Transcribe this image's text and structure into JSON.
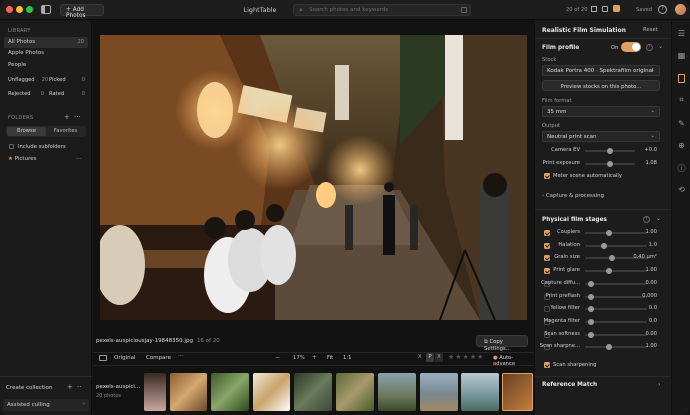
{
  "app": {
    "title": "LightTable",
    "counter": "20 of 20",
    "saved": "Saved",
    "add_photos": "Add Photos",
    "search_placeholder": "Search photos and keywords"
  },
  "library": {
    "header": "LIBRARY",
    "items": [
      {
        "label": "All Photos",
        "count": "20"
      },
      {
        "label": "Apple Photos",
        "count": ""
      },
      {
        "label": "People",
        "count": ""
      }
    ],
    "unflagged": "Unflagged",
    "unflagged_count": "20",
    "picked": "Picked",
    "picked_count": "0",
    "rejected": "Rejected",
    "rejected_count": "0",
    "rated": "Rated",
    "rated_count": "0"
  },
  "folders": {
    "header": "FOLDERS",
    "tab_browse": "Browse",
    "tab_favorites": "Favorites",
    "include_sub": "Include subfolders",
    "pictures": "Pictures"
  },
  "sidebar_bottom": {
    "create": "Create collection",
    "assisted": "Assisted culling"
  },
  "photo": {
    "filename": "pexels-auspiciousjay-19848350.jpg",
    "position": "16 of 20",
    "copy_settings": "Copy Settings..."
  },
  "toolbar": {
    "original": "Original",
    "compare": "Compare",
    "zoom": "17%",
    "fit": "Fit",
    "one_to_one": "1:1",
    "flag_p": "P",
    "flag_x": "X",
    "stars": "★★★★★",
    "auto_advance": "Auto-advance"
  },
  "filmstrip": {
    "name": "pexels-auspici...",
    "count": "20 photos"
  },
  "panel": {
    "title": "Realistic Film Simulation",
    "reset": "Reset",
    "film_profile": "Film profile",
    "on": "On",
    "stock_label": "Stock",
    "stock_value": "Kodak Portra 400 · Spektrafilm original",
    "preview_btn": "Preview stocks on this photo...",
    "format_label": "Film format",
    "format_value": "35 mm",
    "output_label": "Output",
    "output_value": "Neutral print scan",
    "camera_ev": "Camera EV",
    "camera_ev_val": "+0.0",
    "print_exposure": "Print exposure",
    "print_exposure_val": "1.08",
    "meter_scene": "Meter scene automatically",
    "capture": "Capture & processing",
    "stages": "Physical film stages",
    "stage_rows": [
      {
        "label": "Couplers",
        "val": "1.00",
        "check": true,
        "pos": 0.38
      },
      {
        "label": "Halation",
        "val": "1.0",
        "check": true,
        "pos": 0.28
      },
      {
        "label": "Grain size",
        "val": "0.40 µm²",
        "check": true,
        "pos": 0.42
      },
      {
        "label": "Print glare",
        "val": "1.00",
        "check": true,
        "pos": 0.38
      },
      {
        "label": "Capture diffu...",
        "val": "0.00",
        "check": false,
        "pos": 0.05
      },
      {
        "label": "Print preflash",
        "val": "0.000",
        "check": false,
        "pos": 0.05
      },
      {
        "label": "Yellow filter",
        "val": "0.0",
        "check": false,
        "pos": 0.05
      },
      {
        "label": "Magenta filter",
        "val": "0.0",
        "check": false,
        "pos": 0.05
      },
      {
        "label": "Scan softness",
        "val": "0.00",
        "check": false,
        "pos": 0.05
      },
      {
        "label": "Scan sharpne...",
        "val": "1.00",
        "check": false,
        "pos": 0.38
      }
    ],
    "scan_sharpening": "Scan sharpening",
    "reference": "Reference Match"
  },
  "colors": {
    "accent": "#e0a060",
    "bg": "#151515"
  }
}
